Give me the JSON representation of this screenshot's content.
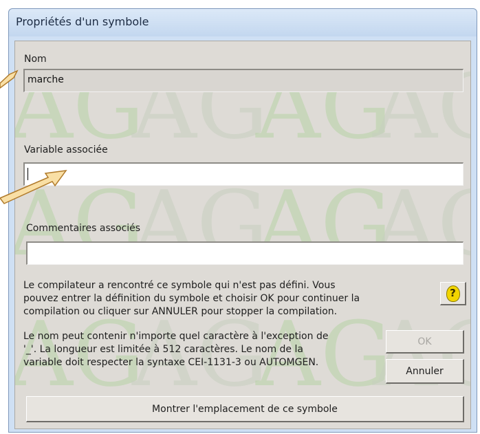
{
  "window": {
    "title": "Propriétés d'un symbole"
  },
  "fields": {
    "nom_label": "Nom",
    "nom_value": "marche",
    "variable_label": "Variable associée",
    "variable_value": "",
    "commentaires_label": "Commentaires associés",
    "commentaires_value": ""
  },
  "messages": {
    "compiler_line1": "Le compilateur a rencontré ce symbole qui n'est pas défini. Vous",
    "compiler_line2": "pouvez entrer la définition du symbole et choisir OK pour continuer la",
    "compiler_line3": "compilation ou cliquer sur ANNULER pour stopper la compilation.",
    "rules_line1": "Le nom peut contenir n'importe quel caractère à l'exception de",
    "rules_line2": "'_'. La longueur est limitée à 512 caractères. Le nom de la",
    "rules_line3": "variable doit respecter la syntaxe CEI-1131-3 ou AUTOMGEN."
  },
  "buttons": {
    "ok": "OK",
    "cancel": "Annuler",
    "show_location": "Montrer l'emplacement de ce symbole",
    "help_glyph": "?"
  },
  "watermark": {
    "letters": "AG"
  },
  "colors": {
    "arrow_fill": "#f9dfa5",
    "arrow_stroke": "#b07a2a",
    "help_yellow": "#f2d500"
  }
}
